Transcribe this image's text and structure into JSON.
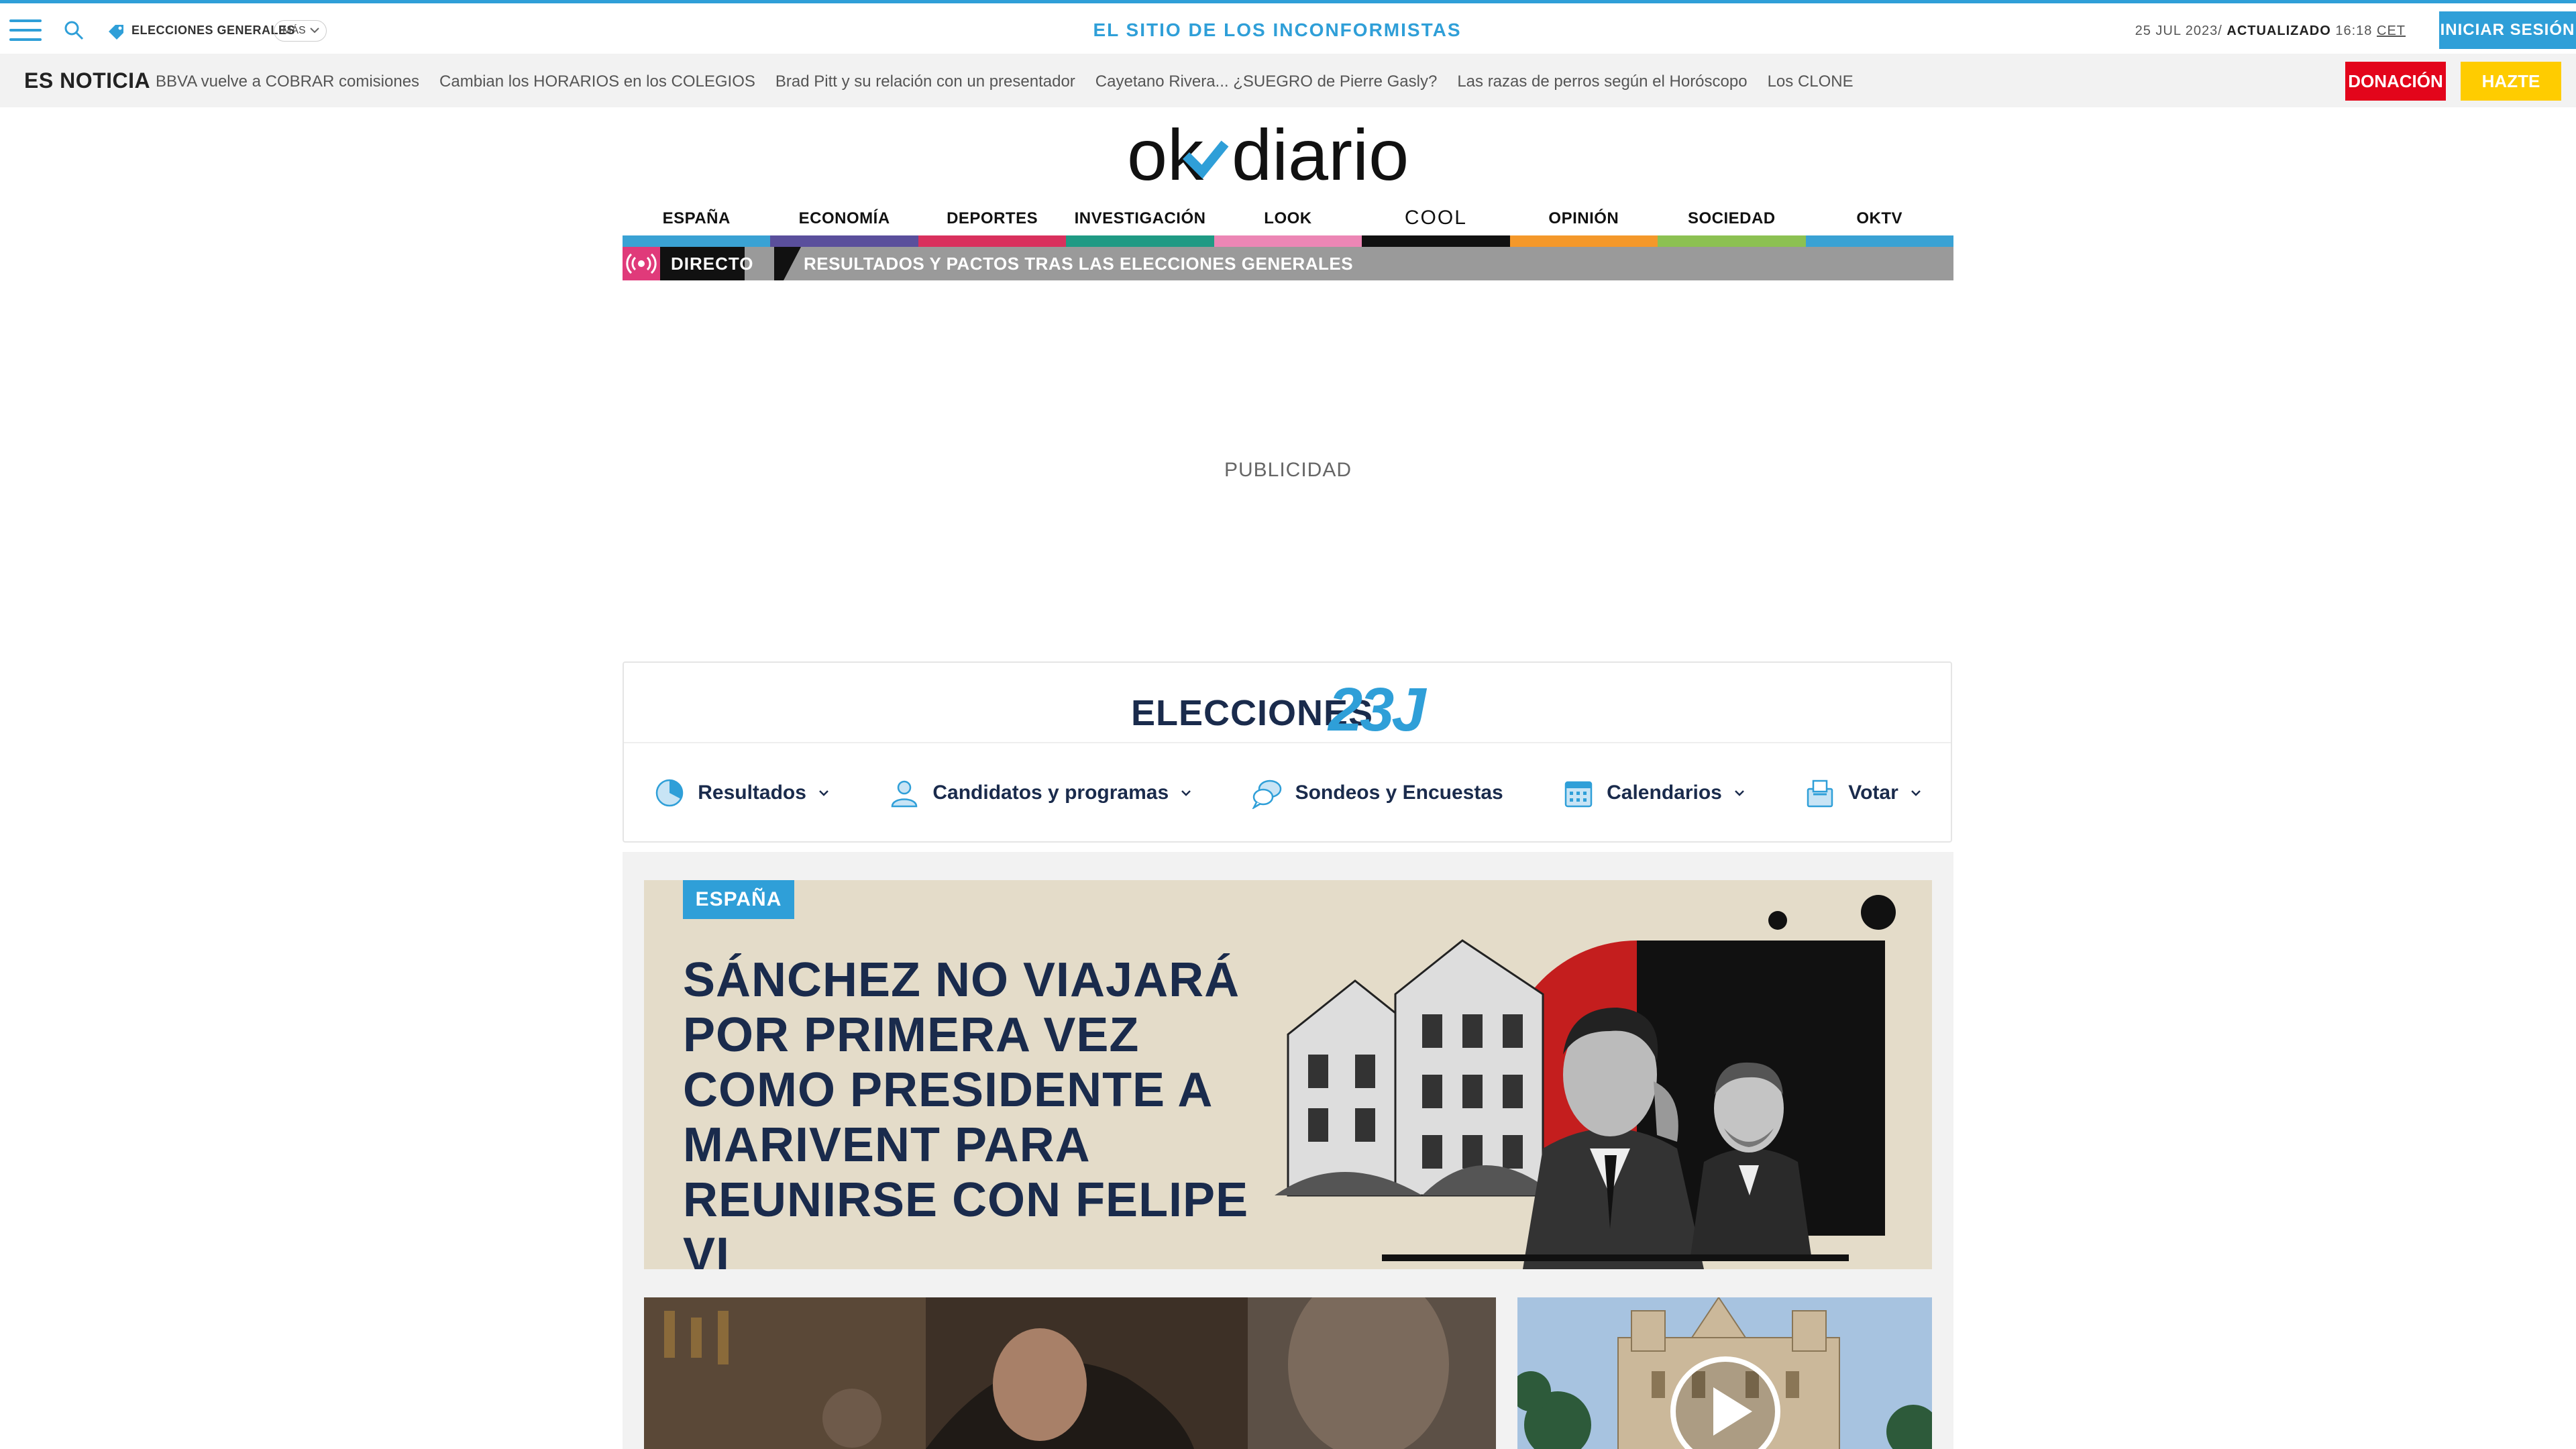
{
  "topbar": {
    "topic_label": "ELECCIONES GENERALES",
    "more_label": "MÁS",
    "slogan": "EL SITIO DE LOS INCONFORMISTAS",
    "date": "25 JUL 2023/",
    "updated_label": "ACTUALIZADO",
    "time": "16:18",
    "tz": "CET",
    "login_label": "INICIAR SESIÓN"
  },
  "trending": {
    "title": "ES NOTICIA",
    "items": [
      "BBVA vuelve a COBRAR comisiones",
      "Cambian los HORARIOS en los COLEGIOS",
      "Brad Pitt y su relación con un presentador",
      "Cayetano Rivera... ¿SUEGRO de Pierre Gasly?",
      "Las razas de perros según el Horóscopo",
      "Los CLONE"
    ],
    "donate_label": "DONACIÓN",
    "member_label": "HAZTE SOCIO"
  },
  "logo": {
    "part1": "ok",
    "part2": "diario"
  },
  "nav": {
    "items": [
      {
        "label": "ESPAÑA",
        "color": "#3aa2d4"
      },
      {
        "label": "ECONOMÍA",
        "color": "#5a4f9c"
      },
      {
        "label": "DEPORTES",
        "color": "#d9305d"
      },
      {
        "label": "INVESTIGACIÓN",
        "color": "#1f9a84"
      },
      {
        "label": "LOOK",
        "color": "#ec86b5"
      },
      {
        "label": "COOL",
        "color": "#111111"
      },
      {
        "label": "OPINIÓN",
        "color": "#f4982a"
      },
      {
        "label": "SOCIEDAD",
        "color": "#8cc152"
      },
      {
        "label": "OKTV",
        "color": "#3aa2d4"
      }
    ]
  },
  "live": {
    "label": "DIRECTO",
    "text": "RESULTADOS Y PACTOS TRAS LAS ELECCIONES GENERALES"
  },
  "ad": {
    "label": "PUBLICIDAD"
  },
  "elections": {
    "title": "ELECCIONES",
    "badge": "23J",
    "menu": [
      {
        "label": "Resultados",
        "icon": "pie-chart-icon",
        "has_dropdown": true
      },
      {
        "label": "Candidatos y programas",
        "icon": "user-icon",
        "has_dropdown": true
      },
      {
        "label": "Sondeos y Encuestas",
        "icon": "chat-bubbles-icon",
        "has_dropdown": false
      },
      {
        "label": "Calendarios",
        "icon": "calendar-icon",
        "has_dropdown": true
      },
      {
        "label": "Votar",
        "icon": "ballot-box-icon",
        "has_dropdown": true
      }
    ]
  },
  "feature": {
    "section": "ESPAÑA",
    "headline": "SÁNCHEZ NO VIAJARÁ POR PRIMERA VEZ COMO PRESIDENTE A MARIVENT PARA REUNIRSE CON FELIPE VI"
  },
  "colors": {
    "accent": "#2f9fd8",
    "red": "#e3051b",
    "yellow": "#ffcc00",
    "navy": "#1a2b4c"
  }
}
